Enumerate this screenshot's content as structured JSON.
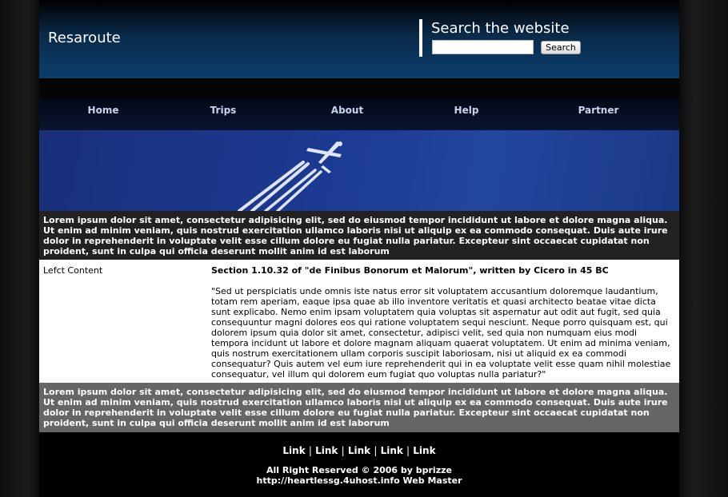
{
  "header": {
    "site_title": "Resaroute",
    "search_title": "Search the website",
    "search_value": "",
    "search_button": "Search"
  },
  "nav": {
    "items": [
      "Home",
      "Trips",
      "About",
      "Help",
      "Partner"
    ]
  },
  "top_block": {
    "text": "Lorem ipsum dolor sit amet, consectetur adipisicing elit, sed do eiusmod tempor incididunt ut labore et dolore magna aliqua. Ut enim ad minim veniam, quis nostrud exercitation ullamco laboris nisi ut aliquip ex ea commodo consequat. Duis aute irure dolor in reprehenderit in voluptate velit esse cillum dolore eu fugiat nulla pariatur. Excepteur sint occaecat cupidatat non proident, sunt in culpa qui officia deserunt mollit anim id est laborum"
  },
  "content": {
    "left_label": "Lefct Content",
    "section_title": "Section 1.10.32 of \"de Finibus Bonorum et Malorum\", written by Cicero in 45 BC",
    "quote": "\"Sed ut perspiciatis unde omnis iste natus error sit voluptatem accusantium doloremque laudantium, totam rem aperiam, eaque ipsa quae ab illo inventore veritatis et quasi architecto beatae vitae dicta sunt explicabo. Nemo enim ipsam voluptatem quia voluptas sit aspernatur aut odit aut fugit, sed quia consequuntur magni dolores eos qui ratione voluptatem sequi nesciunt. Neque porro quisquam est, qui dolorem ipsum quia dolor sit amet, consectetur, adipisci velit, sed quia non numquam eius modi tempora incidunt ut labore et dolore magnam aliquam quaerat voluptatem. Ut enim ad minima veniam, quis nostrum exercitationem ullam corporis suscipit laboriosam, nisi ut aliquid ex ea commodi consequatur? Quis autem vel eum iure reprehenderit qui in ea voluptate velit esse quam nihil molestiae consequatur, vel illum qui dolorem eum fugiat quo voluptas nulla pariatur?\""
  },
  "bottom_block": {
    "text": "Lorem ipsum dolor sit amet, consectetur adipisicing elit, sed do eiusmod tempor incididunt ut labore et dolore magna aliqua. Ut enim ad minim veniam, quis nostrud exercitation ullamco laboris nisi ut aliquip ex ea commodo consequat. Duis aute irure dolor in reprehenderit in voluptate velit esse cillum dolore eu fugiat nulla pariatur. Excepteur sint occaecat cupidatat non proident, sunt in culpa qui officia deserunt mollit anim id est laborum"
  },
  "footer": {
    "links": [
      "Link",
      "Link",
      "Link",
      "Link",
      "Link"
    ],
    "separator": "|",
    "copyright": "All Right Reserved © 2006 by bprizze",
    "webmaster": "http://heartlessg.4uhost.info Web Master"
  }
}
